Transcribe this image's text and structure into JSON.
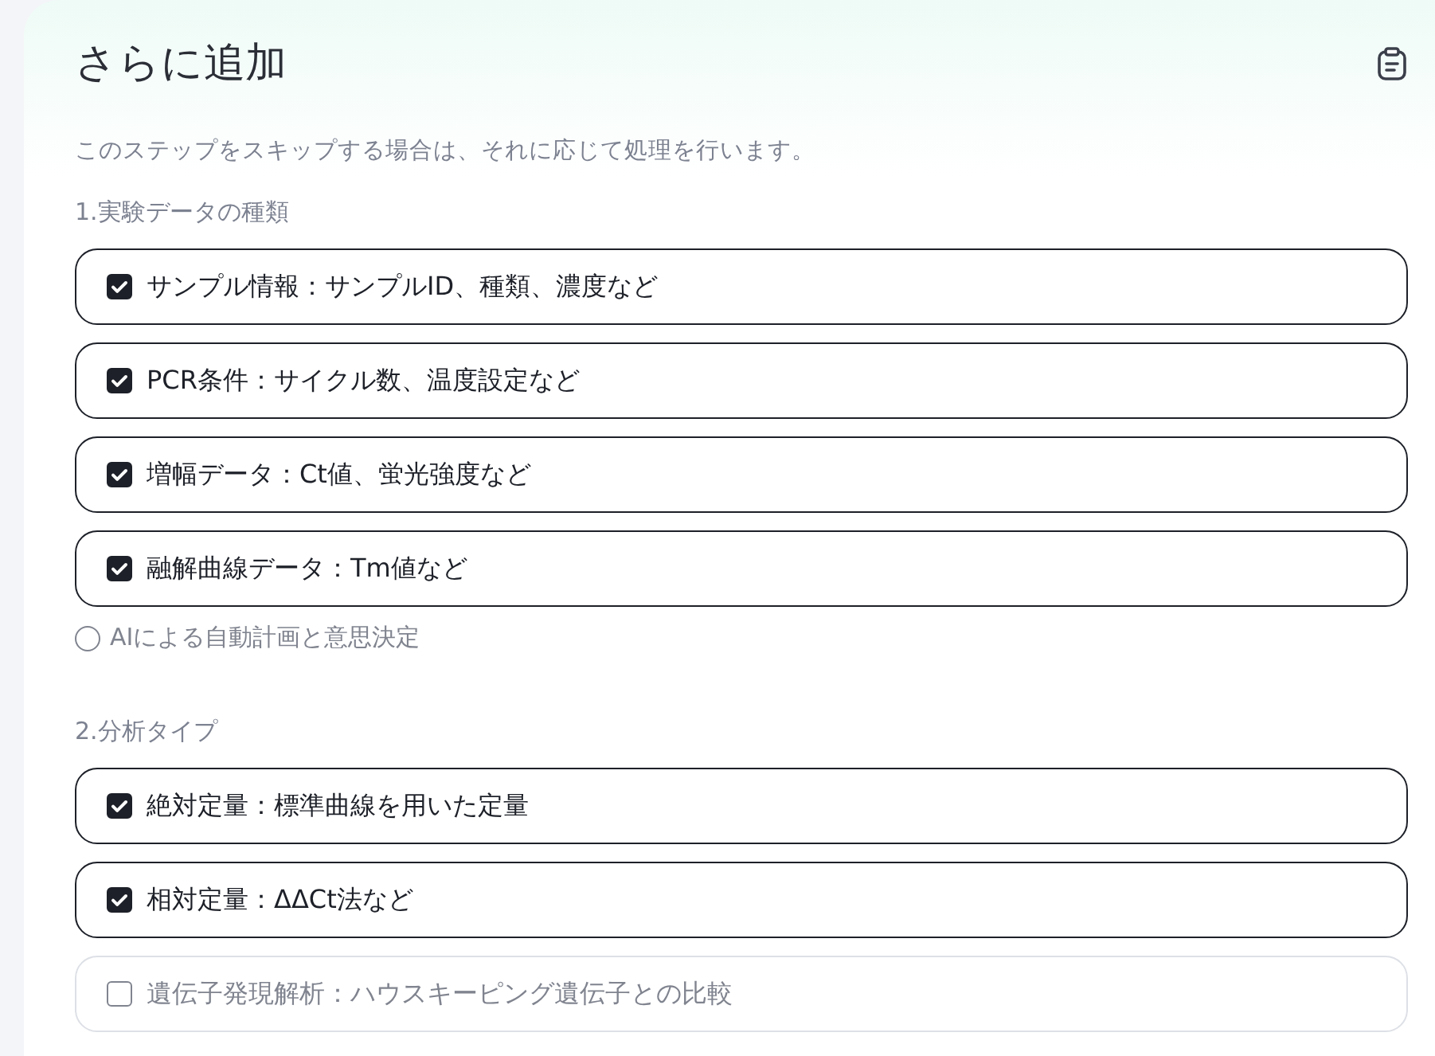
{
  "title": "さらに追加",
  "description": "このステップをスキップする場合は、それに応じて処理を行います。",
  "sections": [
    {
      "heading": "1.実験データの種類",
      "options": [
        {
          "label": "サンプル情報：サンプルID、種類、濃度など",
          "checked": true
        },
        {
          "label": "PCR条件：サイクル数、温度設定など",
          "checked": true
        },
        {
          "label": "増幅データ：Ct値、蛍光強度など",
          "checked": true
        },
        {
          "label": "融解曲線データ：Tm値など",
          "checked": true
        }
      ],
      "radio": {
        "label": "AIによる自動計画と意思決定",
        "selected": false
      }
    },
    {
      "heading": "2.分析タイプ",
      "options": [
        {
          "label": "絶対定量：標準曲線を用いた定量",
          "checked": true
        },
        {
          "label": "相対定量：ΔΔCt法など",
          "checked": true
        },
        {
          "label": "遺伝子発現解析：ハウスキーピング遺伝子との比較",
          "checked": false
        }
      ]
    }
  ]
}
